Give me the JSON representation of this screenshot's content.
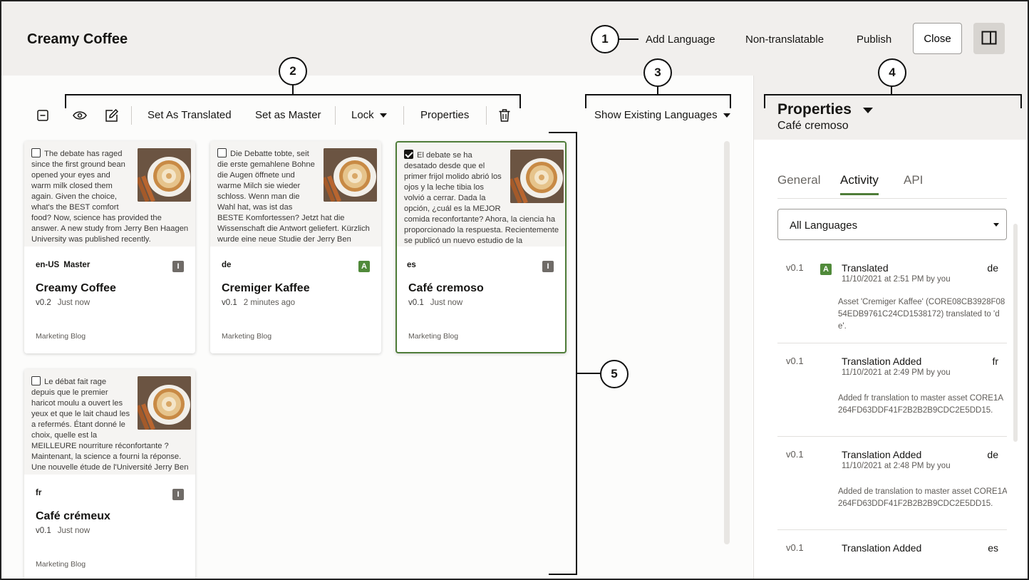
{
  "header": {
    "title": "Creamy Coffee",
    "add_language": "Add Language",
    "non_translatable": "Non-translatable",
    "publish": "Publish",
    "close": "Close"
  },
  "callouts": [
    "1",
    "2",
    "3",
    "4",
    "5"
  ],
  "toolbar": {
    "set_as_translated": "Set As Translated",
    "set_as_master": "Set as Master",
    "lock": "Lock",
    "properties": "Properties",
    "show_existing_languages": "Show Existing Languages"
  },
  "cards": [
    {
      "excerpt": "The debate has raged since the first ground bean opened your eyes and warm milk closed them again. Given the choice, what's the BEST comfort food? Now, science has provided the answer. A new study from Jerry Ben Haagen University was published recently.",
      "lang": "en-US",
      "master": "Master",
      "badge": "I",
      "title": "Creamy Coffee",
      "version": "v0.2",
      "time": "Just now",
      "collection": "Marketing Blog",
      "checked": false
    },
    {
      "excerpt": "Die Debatte tobte, seit die erste gemahlene Bohne die Augen öffnete und warme Milch sie wieder schloss. Wenn man die Wahl hat, was ist das BESTE Komfortessen? Jetzt hat die Wissenschaft die Antwort geliefert. Kürzlich wurde eine neue Studie der Jerry Ben Haagen",
      "lang": "de",
      "master": "",
      "badge": "A",
      "title": "Cremiger Kaffee",
      "version": "v0.1",
      "time": "2 minutes ago",
      "collection": "Marketing Blog",
      "checked": false
    },
    {
      "excerpt": "El debate se ha desatado desde que el primer frijol molido abrió los ojos y la leche tibia los volvió a cerrar. Dada la opción, ¿cuál es la MEJOR comida reconfortante? Ahora, la ciencia ha proporcionado la respuesta. Recientemente se publicó un nuevo estudio de la",
      "lang": "es",
      "master": "",
      "badge": "I",
      "title": "Café cremoso",
      "version": "v0.1",
      "time": "Just now",
      "collection": "Marketing Blog",
      "checked": true
    },
    {
      "excerpt": "Le débat fait rage depuis que le premier haricot moulu a ouvert les yeux et que le lait chaud les a refermés. Étant donné le choix, quelle est la MEILLEURE nourriture réconfortante ? Maintenant, la science a fourni la réponse. Une nouvelle étude de l'Université Jerry Ben Haagen a",
      "lang": "fr",
      "master": "",
      "badge": "I",
      "title": "Café crémeux",
      "version": "v0.1",
      "time": "Just now",
      "collection": "Marketing Blog",
      "checked": false
    }
  ],
  "panel": {
    "title": "Properties",
    "subtitle": "Café cremoso",
    "tabs": [
      "General",
      "Activity",
      "API"
    ],
    "active_tab": "Activity",
    "language_filter": "All Languages",
    "activities": [
      {
        "version": "v0.1",
        "badge": "A",
        "title": "Translated",
        "lang": "de",
        "date": "11/10/2021 at 2:51 PM by you",
        "desc": "Asset 'Cremiger Kaffee' (CORE08CB3928F0854EDB9761C24CD1538172) translated to 'de'."
      },
      {
        "version": "v0.1",
        "badge": "",
        "title": "Translation Added",
        "lang": "fr",
        "date": "11/10/2021 at 2:49 PM by you",
        "desc": "Added fr translation to master asset CORE1A264FD63DDF41F2B2B2B9CDC2E5DD15."
      },
      {
        "version": "v0.1",
        "badge": "",
        "title": "Translation Added",
        "lang": "de",
        "date": "11/10/2021 at 2:48 PM by you",
        "desc": "Added de translation to master asset CORE1A264FD63DDF41F2B2B2B9CDC2E5DD15."
      },
      {
        "version": "v0.1",
        "badge": "",
        "title": "Translation Added",
        "lang": "es",
        "date": "",
        "desc": ""
      }
    ]
  },
  "colors": {
    "accent": "#4f7d39",
    "badge_approved": "#508a3a",
    "badge_inprogress": "#6f6b67",
    "header_bg": "#f1efed"
  }
}
